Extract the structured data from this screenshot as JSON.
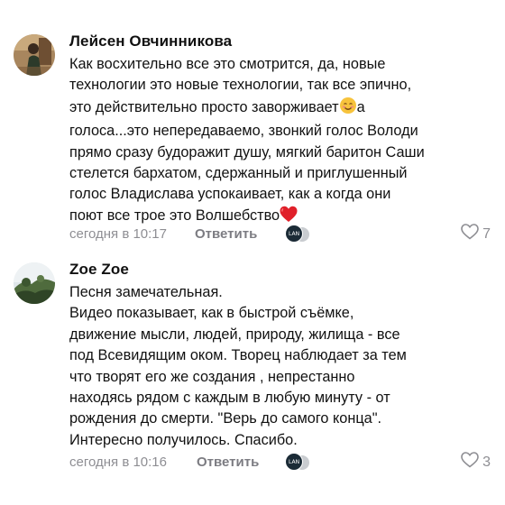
{
  "comments": [
    {
      "author": "Лейсен Овчинникова",
      "lines": [
        "Как восхительно все это смотрится, да, новые",
        "технологии это новые технологии, так все эпично,",
        "это действительно просто заворживает",
        "голоса...это непередаваемо, звонкий голос Володи",
        "прямо сразу будоражит душу, мягкий баритон Саши",
        "стелется бархатом, сдержанный и приглушенный",
        "голос Владислава успокаивает,  как а когда они",
        "поют все трое это Волшебство"
      ],
      "line3_suffix": "а",
      "timestamp": "сегодня в 10:17",
      "reply_label": "Ответить",
      "liker_label": "LAN",
      "likes": "7"
    },
    {
      "author": "Zoe Zoe",
      "lines": [
        "Песня замечательная.",
        "Видео показывает, как в быстрой съёмке,",
        "движение мысли, людей, природу, жилища - все",
        "под Всевидящим оком.  Творец наблюдает за тем",
        "что творят его же создания   , непрестанно",
        "находясь рядом с каждым в любую минуту - от",
        "рождения до смерти. \"Верь до самого конца\".",
        "Интересно получилось. Спасибо."
      ],
      "timestamp": "сегодня в 10:16",
      "reply_label": "Ответить",
      "liker_label": "LAN",
      "likes": "3"
    }
  ],
  "icons": {
    "smile": "smiling-face-emoji-icon",
    "heart": "red-heart-emoji-icon",
    "like": "heart-outline-icon"
  },
  "colors": {
    "meta": "#8e8e93",
    "text": "#111111",
    "heart": "#e0202a"
  }
}
